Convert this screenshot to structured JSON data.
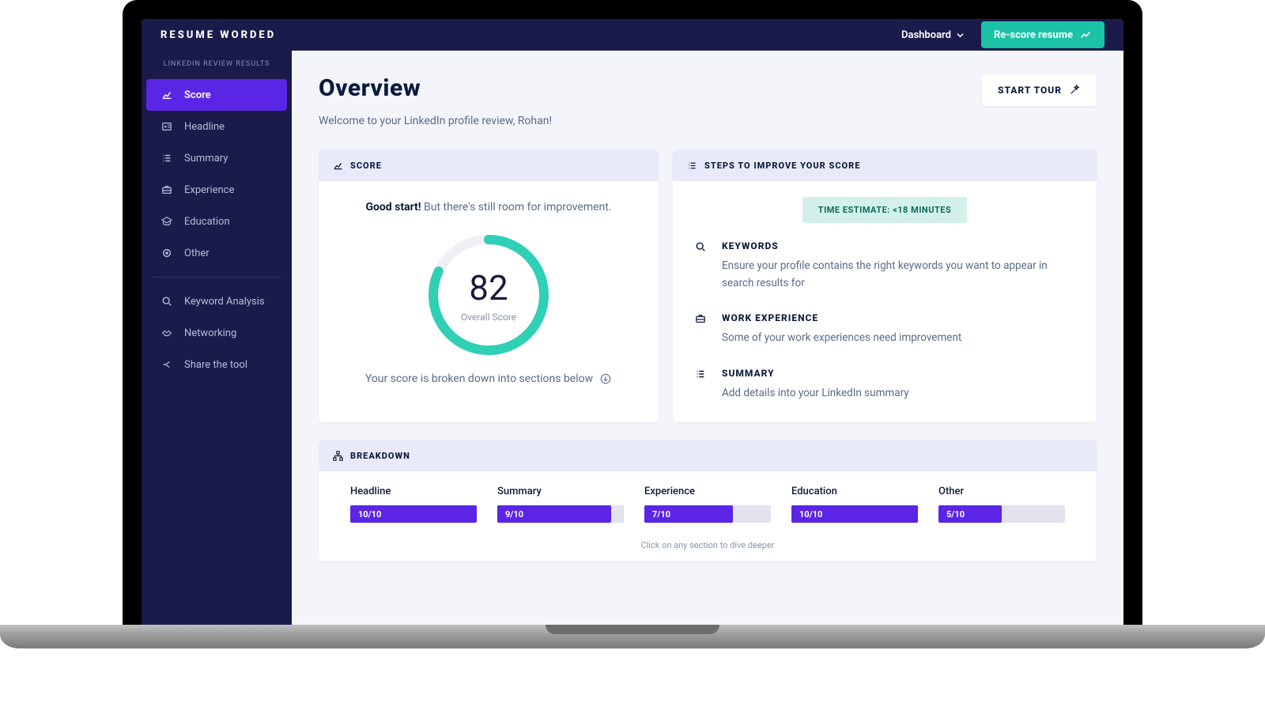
{
  "brand": "RESUME WORDED",
  "topbar": {
    "dashboard": "Dashboard",
    "rescore": "Re-score resume"
  },
  "sidebar": {
    "heading": "LINKEDIN REVIEW RESULTS",
    "items": [
      {
        "label": "Score",
        "icon": "chart"
      },
      {
        "label": "Headline",
        "icon": "id"
      },
      {
        "label": "Summary",
        "icon": "list"
      },
      {
        "label": "Experience",
        "icon": "briefcase"
      },
      {
        "label": "Education",
        "icon": "grad"
      },
      {
        "label": "Other",
        "icon": "circle"
      }
    ],
    "extras": [
      {
        "label": "Keyword Analysis",
        "icon": "search"
      },
      {
        "label": "Networking",
        "icon": "handshake"
      },
      {
        "label": "Share the tool",
        "icon": "share"
      }
    ]
  },
  "main": {
    "title": "Overview",
    "welcome": "Welcome to your LinkedIn profile review, Rohan!",
    "start_tour": "START TOUR"
  },
  "score_card": {
    "header": "SCORE",
    "good_bold": "Good start!",
    "good_rest": " But there's still room for improvement. ",
    "value": 82,
    "value_label": "Overall Score",
    "foot": "Your score is broken down into sections below"
  },
  "steps_card": {
    "header": "STEPS TO IMPROVE YOUR SCORE",
    "time": "TIME ESTIMATE: <18 MINUTES",
    "items": [
      {
        "title": "KEYWORDS",
        "desc": "Ensure your profile contains the right keywords you want to appear in search results for",
        "icon": "search"
      },
      {
        "title": "WORK EXPERIENCE",
        "desc": "Some of your work experiences need improvement",
        "icon": "briefcase"
      },
      {
        "title": "SUMMARY",
        "desc": "Add details into your LinkedIn summary",
        "icon": "list"
      }
    ]
  },
  "breakdown": {
    "header": "BREAKDOWN",
    "items": [
      {
        "label": "Headline",
        "score": "10/10",
        "pct": 100
      },
      {
        "label": "Summary",
        "score": "9/10",
        "pct": 90
      },
      {
        "label": "Experience",
        "score": "7/10",
        "pct": 70
      },
      {
        "label": "Education",
        "score": "10/10",
        "pct": 100
      },
      {
        "label": "Other",
        "score": "5/10",
        "pct": 50
      }
    ],
    "foot": "Click on any section to dive deeper"
  },
  "colors": {
    "accent": "#5b25e6",
    "teal": "#1bc2a6",
    "navy": "#1a1b4a"
  },
  "chart_data": {
    "type": "bar",
    "title": "Breakdown",
    "categories": [
      "Headline",
      "Summary",
      "Experience",
      "Education",
      "Other"
    ],
    "values": [
      10,
      9,
      7,
      10,
      5
    ],
    "ylim": [
      0,
      10
    ],
    "overall_score": 82
  }
}
